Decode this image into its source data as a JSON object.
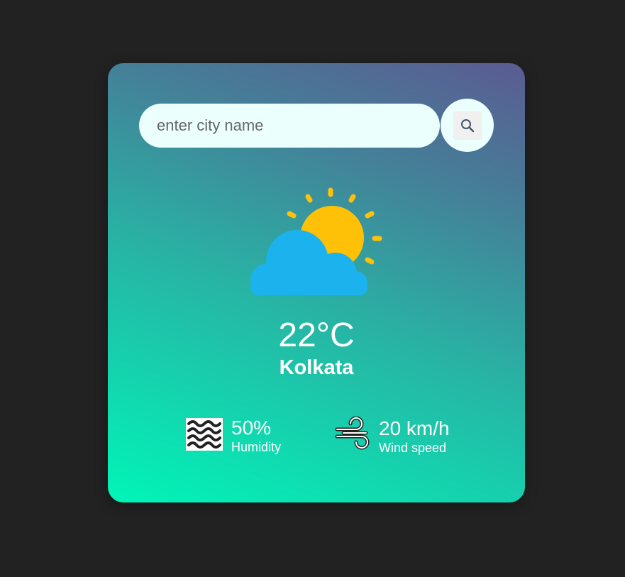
{
  "search": {
    "placeholder": "enter city name",
    "value": "",
    "button_icon": "search-icon"
  },
  "weather": {
    "icon": "partly-cloudy-icon",
    "temperature": "22°C",
    "city": "Kolkata"
  },
  "humidity": {
    "icon": "humidity-waves-icon",
    "value": "50%",
    "label": "Humidity"
  },
  "wind": {
    "icon": "wind-icon",
    "value": "20 km/h",
    "label": "Wind speed"
  },
  "colors": {
    "background": "#222222",
    "card_top": "#5b5b92",
    "card_bottom": "#00f5b8",
    "search_bg": "#ebfffc",
    "sun": "#ffc107",
    "cloud": "#1cb2ee"
  }
}
